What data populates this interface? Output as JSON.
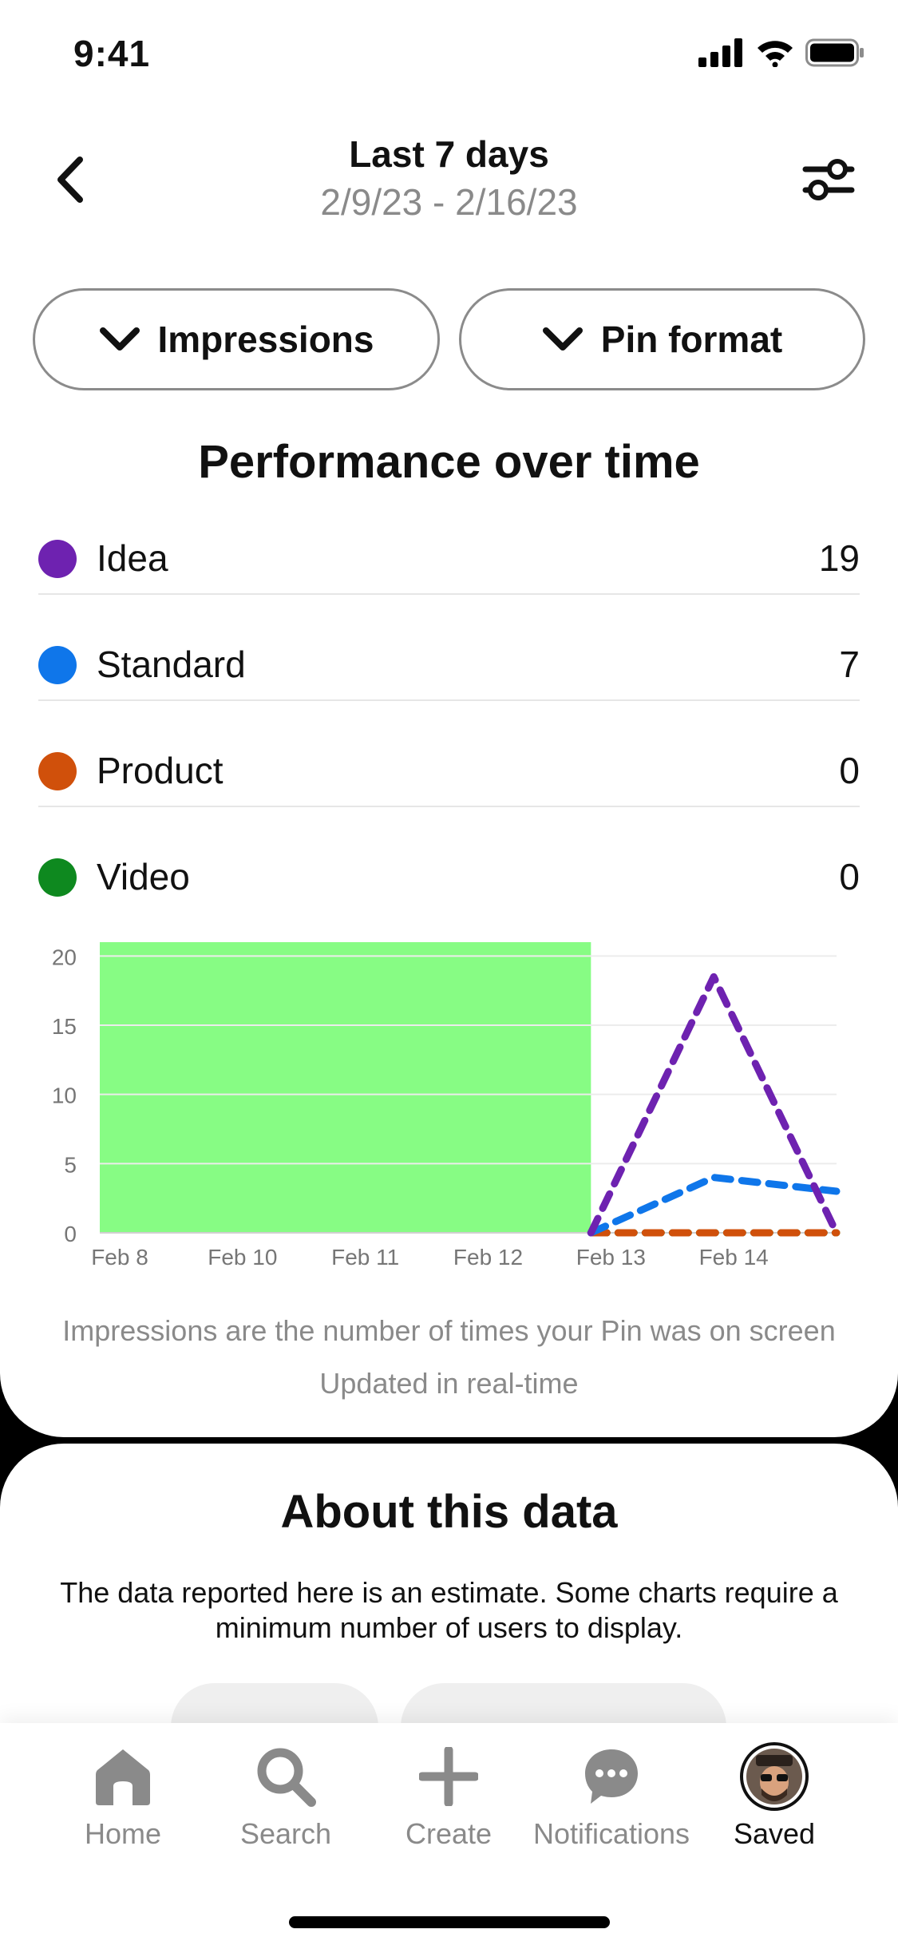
{
  "status_bar": {
    "time": "9:41"
  },
  "header": {
    "title": "Last 7 days",
    "subtitle": "2/9/23 - 2/16/23"
  },
  "filters": [
    {
      "label": "Impressions"
    },
    {
      "label": "Pin format"
    }
  ],
  "section_title": "Performance over time",
  "legend": [
    {
      "label": "Idea",
      "value": "19",
      "color": "#6e22b0"
    },
    {
      "label": "Standard",
      "value": "7",
      "color": "#0f76ea"
    },
    {
      "label": "Product",
      "value": "0",
      "color": "#d0500b"
    },
    {
      "label": "Video",
      "value": "0",
      "color": "#0e891f"
    }
  ],
  "chart_data": {
    "type": "line",
    "x": [
      "Feb 8",
      "Feb 10",
      "Feb 11",
      "Feb 12",
      "Feb 13",
      "Feb 14",
      "Feb 15"
    ],
    "x_tick_labels": [
      "Feb 8",
      "Feb 10",
      "Feb 11",
      "Feb 12",
      "Feb 13",
      "Feb 14"
    ],
    "y_ticks": [
      0,
      5,
      10,
      15,
      20
    ],
    "ylim": [
      0,
      21
    ],
    "grid": true,
    "line_style": "dashed",
    "highlight": {
      "from": "Feb 8",
      "to": "Feb 13",
      "color": "#87fc84"
    },
    "series": [
      {
        "name": "Idea",
        "color": "#6e22b0",
        "x": [
          "Feb 13",
          "Feb 14",
          "Feb 15"
        ],
        "values": [
          0,
          18.5,
          0
        ]
      },
      {
        "name": "Standard",
        "color": "#0f76ea",
        "x": [
          "Feb 13",
          "Feb 14",
          "Feb 15"
        ],
        "values": [
          0,
          4,
          3
        ]
      },
      {
        "name": "Product",
        "color": "#d0500b",
        "x": [
          "Feb 13",
          "Feb 14",
          "Feb 15"
        ],
        "values": [
          0,
          0,
          0
        ]
      },
      {
        "name": "Video",
        "color": "#0e891f",
        "x": [
          "Feb 13",
          "Feb 14",
          "Feb 15"
        ],
        "values": [
          0,
          0,
          0
        ]
      }
    ]
  },
  "captions": {
    "definition": "Impressions are the number of times your Pin was on screen",
    "updated": "Updated in real-time"
  },
  "about": {
    "title": "About this data",
    "text": "The data reported here is an estimate. Some charts require a minimum number of users to display."
  },
  "tabbar": [
    {
      "label": "Home",
      "icon": "home-icon"
    },
    {
      "label": "Search",
      "icon": "search-icon"
    },
    {
      "label": "Create",
      "icon": "plus-icon"
    },
    {
      "label": "Notifications",
      "icon": "chat-bubble-icon"
    },
    {
      "label": "Saved",
      "icon": "avatar"
    }
  ]
}
